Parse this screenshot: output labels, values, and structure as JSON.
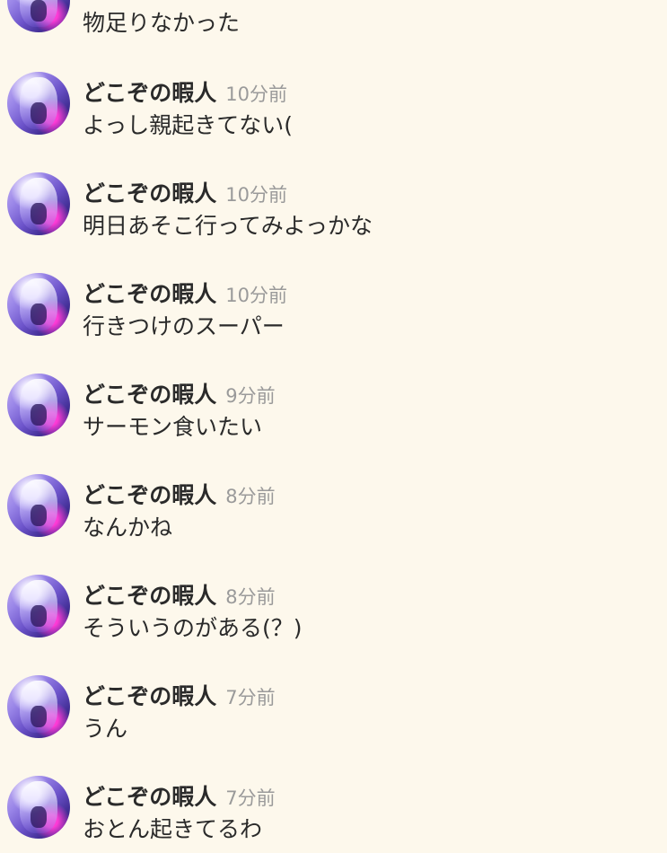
{
  "messages": [
    {
      "name": "",
      "time": "",
      "text": "物足りなかった"
    },
    {
      "name": "どこぞの暇人",
      "time": "10分前",
      "text": "よっし親起きてない("
    },
    {
      "name": "どこぞの暇人",
      "time": "10分前",
      "text": "明日あそこ行ってみよっかな"
    },
    {
      "name": "どこぞの暇人",
      "time": "10分前",
      "text": "行きつけのスーパー"
    },
    {
      "name": "どこぞの暇人",
      "time": "9分前",
      "text": "サーモン食いたい"
    },
    {
      "name": "どこぞの暇人",
      "time": "8分前",
      "text": "なんかね"
    },
    {
      "name": "どこぞの暇人",
      "time": "8分前",
      "text": "そういうのがある(？)"
    },
    {
      "name": "どこぞの暇人",
      "time": "7分前",
      "text": "うん"
    },
    {
      "name": "どこぞの暇人",
      "time": "7分前",
      "text": "おとん起きてるわ"
    }
  ]
}
